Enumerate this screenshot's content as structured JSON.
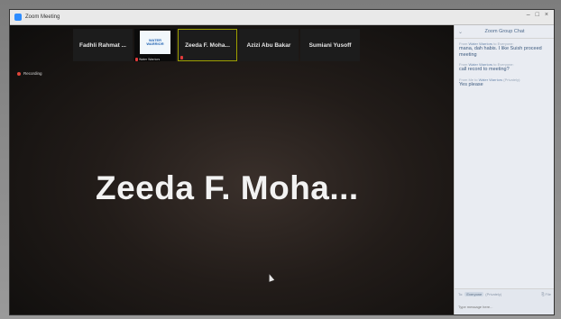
{
  "window": {
    "title": "Zoom Meeting",
    "controls": [
      "–",
      "□",
      "×"
    ]
  },
  "filmstrip": {
    "participants": [
      {
        "name": "Fadhli Rahmat ..."
      },
      {
        "video_logo_text": "WATER WARRIOR",
        "label": "Water Warriors"
      },
      {
        "name": "Zeeda F. Moha..."
      },
      {
        "name": "Azizi Abu Bakar"
      },
      {
        "name": "Sumiani Yusoff"
      }
    ]
  },
  "recording": {
    "label": "Recording"
  },
  "active_speaker": {
    "name": "Zeeda F. Moha..."
  },
  "chat": {
    "title": "Zoom Group Chat",
    "messages": [
      {
        "meta_prefix": "From",
        "sender": "Water Warriors",
        "meta_suffix": "to Everyone:",
        "text": "mana, dah habis. I like Suish proceed meeting"
      },
      {
        "meta_prefix": "From",
        "sender": "Water Warriors",
        "meta_suffix": "to Everyone:",
        "text": "call record to meeting?"
      },
      {
        "meta_prefix": "From Me to",
        "sender": "Water Warriors",
        "meta_suffix": "(Privately):",
        "text": "Yes please"
      }
    ],
    "to_label": "To:",
    "to_value": "Everyone",
    "privately_label": "(Privately)",
    "file_label": "File",
    "input_placeholder": "Type message here..."
  },
  "colors": {
    "accent_blue": "#2d8cff",
    "active_border": "#9ea000",
    "recording_red": "#e0463a"
  }
}
